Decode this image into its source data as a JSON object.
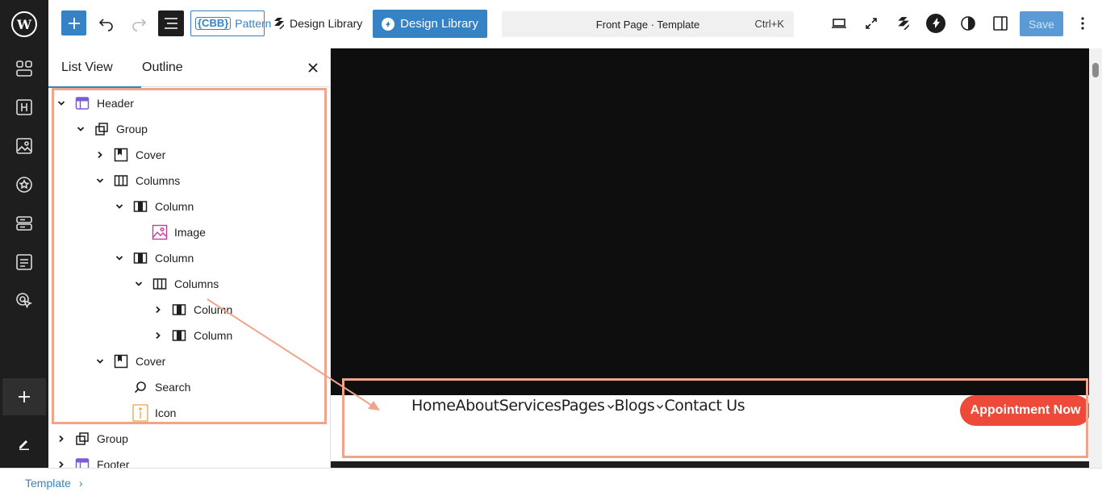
{
  "colors": {
    "accent": "#3582c4",
    "sidebar_bg": "#1e1e1e",
    "highlight": "#f0a58a",
    "cta": "#ed4a3a"
  },
  "sidebar": {
    "icons": [
      "wordpress-logo-icon",
      "grid-layout-icon",
      "heading-icon",
      "image-icon",
      "badge-star-icon",
      "stack-layout-icon",
      "list-doc-icon",
      "pointer-target-icon",
      "add-icon",
      "edit-pencil-icon"
    ]
  },
  "toolbar": {
    "pattern_badge": "{CBB}",
    "pattern_label": "Pattern",
    "design_library_plain": "Design Library",
    "design_library_button": "Design Library",
    "command_title": "Front Page · Template",
    "command_shortcut": "Ctrl+K",
    "save_label": "Save"
  },
  "panel": {
    "tabs": [
      "List View",
      "Outline"
    ],
    "tree": [
      {
        "label": "Header",
        "icon": "template-part-icon",
        "expanded": true,
        "depth": 0
      },
      {
        "label": "Group",
        "icon": "group-icon",
        "expanded": true,
        "depth": 1
      },
      {
        "label": "Cover",
        "icon": "cover-icon",
        "expanded": false,
        "depth": 2
      },
      {
        "label": "Columns",
        "icon": "columns-icon",
        "expanded": true,
        "depth": 2
      },
      {
        "label": "Column",
        "icon": "column-icon",
        "expanded": true,
        "depth": 3
      },
      {
        "label": "Image",
        "icon": "image-block-icon",
        "expanded": null,
        "depth": 4
      },
      {
        "label": "Column",
        "icon": "column-icon",
        "expanded": true,
        "depth": 3
      },
      {
        "label": "Columns",
        "icon": "columns-icon",
        "expanded": true,
        "depth": 4
      },
      {
        "label": "Column",
        "icon": "column-icon",
        "expanded": false,
        "depth": 5
      },
      {
        "label": "Column",
        "icon": "column-icon",
        "expanded": false,
        "depth": 5
      },
      {
        "label": "Cover",
        "icon": "cover-icon",
        "expanded": true,
        "depth": 2
      },
      {
        "label": "Search",
        "icon": "search-icon",
        "expanded": null,
        "depth": 3
      },
      {
        "label": "Icon",
        "icon": "icon-block-icon",
        "expanded": null,
        "depth": 3
      },
      {
        "label": "Group",
        "icon": "group-icon",
        "expanded": false,
        "depth": 0
      },
      {
        "label": "Footer",
        "icon": "template-part-icon",
        "expanded": false,
        "depth": 0
      }
    ]
  },
  "canvas": {
    "nav_items": [
      "Home",
      "About",
      "Services",
      "Pages",
      "Blogs",
      "Contact Us"
    ],
    "nav_dropdowns": [
      "Pages",
      "Blogs"
    ],
    "cta_label": "Appointment Now"
  },
  "breadcrumb": {
    "label": "Template",
    "separator": "›"
  }
}
